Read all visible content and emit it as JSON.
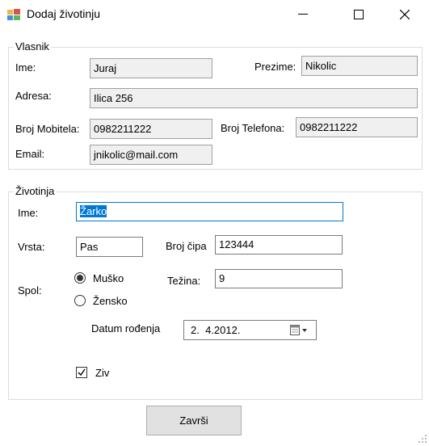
{
  "window": {
    "title": "Dodaj životinju"
  },
  "vlasnik": {
    "legend": "Vlasnik",
    "ime_label": "Ime:",
    "ime_value": "Juraj",
    "prezime_label": "Prezime:",
    "prezime_value": "Nikolic",
    "adresa_label": "Adresa:",
    "adresa_value": "Ilica 256",
    "mobitel_label": "Broj Mobitela:",
    "mobitel_value": "0982211222",
    "telefon_label": "Broj Telefona:",
    "telefon_value": "0982211222",
    "email_label": "Email:",
    "email_value": "jnikolic@mail.com"
  },
  "zivotinja": {
    "legend": "Životinja",
    "ime_label": "Ime:",
    "ime_value": "Žarko",
    "vrsta_label": "Vrsta:",
    "vrsta_value": "Pas",
    "cip_label": "Broj čipa",
    "cip_value": "123444",
    "spol_label": "Spol:",
    "musko_label": "Muško",
    "zensko_label": "Žensko",
    "tezina_label": "Težina:",
    "tezina_value": "9",
    "datum_label": "Datum rođenja",
    "datum_value": "2.  4.2012.",
    "ziv_label": "Ziv",
    "ziv_checked": true
  },
  "actions": {
    "zavrsi_label": "Završi"
  }
}
